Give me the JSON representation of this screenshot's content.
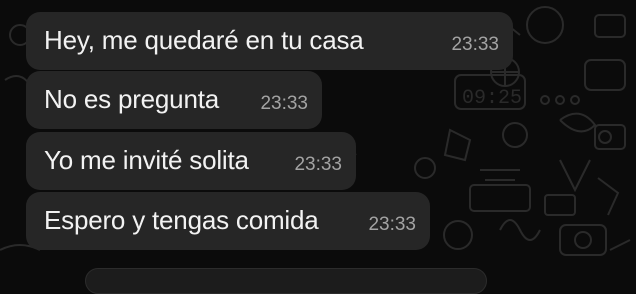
{
  "chat": {
    "messages": [
      {
        "text": "Hey, me quedaré en tu casa",
        "time": "23:33"
      },
      {
        "text": "No es pregunta",
        "time": "23:33"
      },
      {
        "text": "Yo me invité solita",
        "time": "23:33"
      },
      {
        "text": "Espero y tengas comida",
        "time": "23:33"
      }
    ]
  },
  "wallpaper_doodle_clock": "09:25",
  "colors": {
    "background": "#0b0b0b",
    "bubble": "#262626",
    "message_text": "#f2f2f2",
    "timestamp_text": "#a3a3a3"
  }
}
